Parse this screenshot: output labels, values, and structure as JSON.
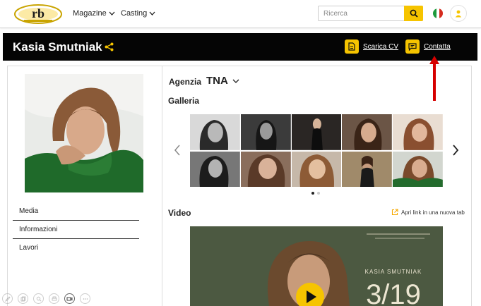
{
  "nav": {
    "logo_text": "rb",
    "menu": [
      {
        "label": "Magazine"
      },
      {
        "label": "Casting"
      }
    ],
    "search_placeholder": "Ricerca",
    "language_icon": "italian-flag-icon",
    "user_icon": "user-icon"
  },
  "profile": {
    "name": "Kasia Smutniak",
    "share_icon": "share-icon",
    "download_cv_label": "Scarica CV",
    "contact_label": "Contatta"
  },
  "sidebar": {
    "items": [
      {
        "label": "Media"
      },
      {
        "label": "Informazioni"
      },
      {
        "label": "Lavori"
      }
    ]
  },
  "agency": {
    "label": "Agenzia",
    "value": "TNA"
  },
  "gallery": {
    "title": "Galleria",
    "photos": [
      1,
      2,
      3,
      4,
      5,
      6,
      7,
      8,
      9,
      10
    ],
    "pages": 2,
    "current_page": 1
  },
  "video": {
    "title": "Video",
    "external_link_label": "Apri link in una nuova tab",
    "poster_name": "KASIA SMUTNIAK",
    "poster_date": "3/19"
  },
  "colors": {
    "accent": "#f6c400",
    "header_bg": "#050505",
    "annotation_arrow": "#d60000"
  }
}
